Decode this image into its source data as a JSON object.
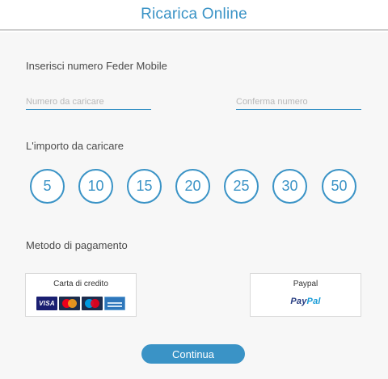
{
  "header": {
    "title": "Ricarica Online"
  },
  "number_section": {
    "label": "Inserisci numero Feder Mobile",
    "number_placeholder": "Numero da caricare",
    "confirm_placeholder": "Conferma numero"
  },
  "amount_section": {
    "label": "L'importo da caricare",
    "amounts": [
      "5",
      "10",
      "15",
      "20",
      "25",
      "30",
      "50"
    ]
  },
  "payment_section": {
    "label": "Metodo di pagamento",
    "credit_card_title": "Carta di credito",
    "card_brands": {
      "visa_label": "VISA",
      "names": [
        "visa",
        "mastercard",
        "maestro",
        "american-express"
      ]
    },
    "paypal_title": "Paypal",
    "paypal_logo": {
      "part1": "Pay",
      "part2": "Pal"
    }
  },
  "continue_label": "Continua",
  "colors": {
    "accent": "#3a93c6",
    "background": "#f7f7f7",
    "divider": "#cfcfcf"
  }
}
